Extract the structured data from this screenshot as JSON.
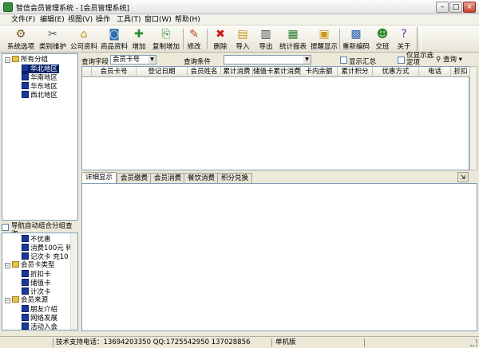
{
  "window": {
    "title": "智信会员管理系统 - [会员管理系统]",
    "min_glyph": "–",
    "max_glyph": "□",
    "close_glyph": "×"
  },
  "menu": [
    "文件(F)",
    "编辑(E)",
    "视图(V)",
    "操作",
    "工具(T)",
    "窗口(W)",
    "帮助(H)"
  ],
  "toolbar": [
    {
      "label": "系统选项",
      "icon": "settings-icon",
      "glyph": "⚙",
      "color": "#7b5a1e"
    },
    {
      "label": "类别维护",
      "icon": "tools-icon",
      "glyph": "✂",
      "color": "#555555"
    },
    {
      "label": "公司资料",
      "icon": "company-icon",
      "glyph": "⌂",
      "color": "#c98d1a"
    },
    {
      "label": "商品资料",
      "icon": "goods-icon",
      "glyph": "◙",
      "color": "#2a6fb0"
    },
    {
      "label": "增加",
      "icon": "add-icon",
      "glyph": "✚",
      "color": "#2d8a2d"
    },
    {
      "label": "复制增加",
      "icon": "copy-add-icon",
      "glyph": "⎘",
      "color": "#2d8a2d"
    },
    {
      "label": "修改",
      "icon": "edit-icon",
      "glyph": "✎",
      "color": "#b84a1a"
    },
    {
      "label": "删除",
      "icon": "delete-icon",
      "glyph": "✖",
      "color": "#cc1a1a"
    },
    {
      "label": "导入",
      "icon": "import-icon",
      "glyph": "▤",
      "color": "#c9971a"
    },
    {
      "label": "导出",
      "icon": "export-icon",
      "glyph": "▥",
      "color": "#444444"
    },
    {
      "label": "统计报表",
      "icon": "report-icon",
      "glyph": "▦",
      "color": "#2d7a2d"
    },
    {
      "label": "提醒显示",
      "icon": "reminder-icon",
      "glyph": "▣",
      "color": "#c9971a"
    },
    {
      "label": "重新编码",
      "icon": "recode-icon",
      "glyph": "▩",
      "color": "#2a5fb0"
    },
    {
      "label": "交班",
      "icon": "shift-icon",
      "glyph": "☻",
      "color": "#2d8a2d"
    },
    {
      "label": "关于",
      "icon": "about-icon",
      "glyph": "?",
      "color": "#6a2aa0"
    }
  ],
  "tree_groups": {
    "root": "所有分组",
    "items": [
      "华北地区",
      "华南地区",
      "华东地区",
      "西北地区"
    ]
  },
  "auto_group_label": "导航自动组合分组查询",
  "tree_nav": [
    {
      "label": "不优惠",
      "level": 2
    },
    {
      "label": "消费100元 转",
      "level": 2
    },
    {
      "label": "记次卡 充10",
      "level": 2
    },
    {
      "label": "会员卡类型",
      "level": 1
    },
    {
      "label": "折扣卡",
      "level": 2
    },
    {
      "label": "储值卡",
      "level": 2
    },
    {
      "label": "计次卡",
      "level": 2
    },
    {
      "label": "会员来源",
      "level": 1
    },
    {
      "label": "朋友介绍",
      "level": 2
    },
    {
      "label": "网络发展",
      "level": 2
    },
    {
      "label": "活动入会",
      "level": 2
    }
  ],
  "query": {
    "field_label": "查询字段",
    "field_value": "会员卡号",
    "condition_label": "查询条件",
    "condition_value": "",
    "show_summary": "显示汇总",
    "show_selected_only": "仅显示选定项",
    "query_button": "查询"
  },
  "grid_columns": [
    "会员卡号",
    "登记日期",
    "会员姓名",
    "累计消费",
    "储值卡累计消费",
    "卡内余额",
    "累计积分",
    "优惠方式",
    "电话",
    "折扣"
  ],
  "tabs": [
    "详细显示",
    "会员缴费",
    "会员消费",
    "餐饮消费",
    "积分兑换"
  ],
  "status": {
    "support": "技术支持电话：13694203350 QQ:1725542950 137028856",
    "mode": "单机版"
  }
}
